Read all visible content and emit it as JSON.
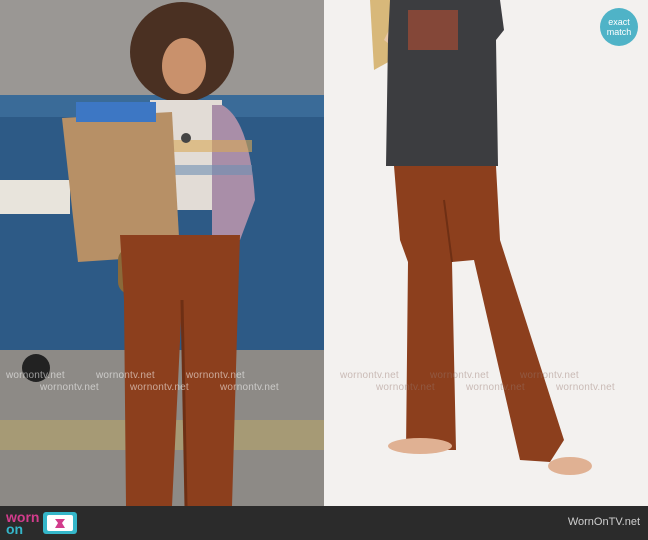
{
  "badge": {
    "line1": "exact",
    "line2": "match"
  },
  "watermark": {
    "text": "wornontv.net"
  },
  "footer": {
    "logo_top": "worn",
    "logo_bottom": "on",
    "site": "WornOnTV.net"
  },
  "colors": {
    "badge": "#4fb3c7",
    "logo_pink": "#d23c8c",
    "logo_teal": "#35b6c9",
    "pants": "#8c3f1d"
  },
  "icons": {
    "tv": "tv-icon"
  }
}
